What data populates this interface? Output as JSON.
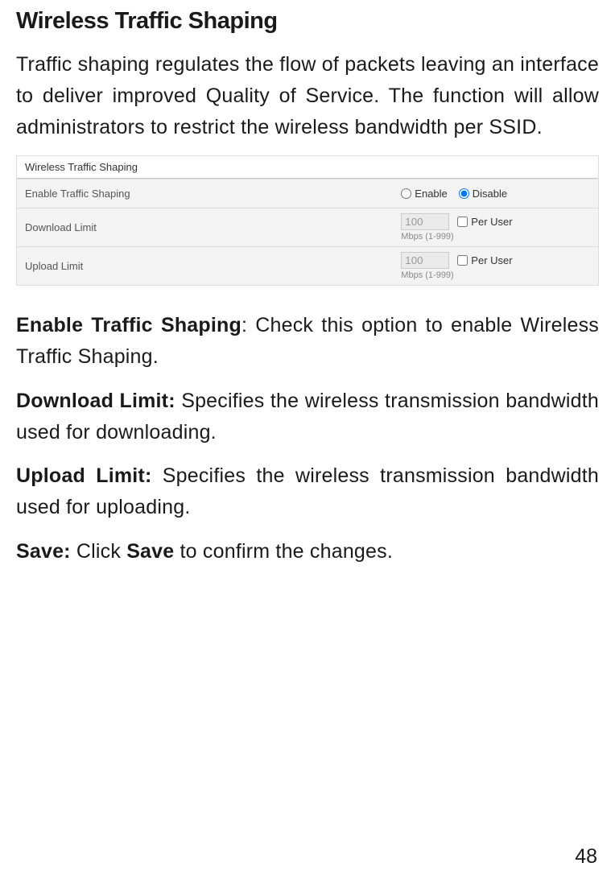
{
  "heading": "Wireless Traffic Shaping",
  "intro": "Traffic shaping regulates the flow of packets leaving an interface to deliver improved Quality of Service. The function will allow administrators to restrict the wireless bandwidth per SSID.",
  "table": {
    "title": "Wireless Traffic Shaping",
    "rows": {
      "enable": {
        "label": "Enable Traffic Shaping",
        "opt_enable": "Enable",
        "opt_disable": "Disable"
      },
      "download": {
        "label": "Download Limit",
        "value": "100",
        "hint": "Mbps (1-999)",
        "per_user": "Per User"
      },
      "upload": {
        "label": "Upload Limit",
        "value": "100",
        "hint": "Mbps (1-999)",
        "per_user": "Per User"
      }
    }
  },
  "defs": {
    "enable_bold": "Enable Traffic Shaping",
    "enable_rest": ": Check this option to enable Wireless Traffic Shaping.",
    "download_bold": "Download Limit:",
    "download_rest": " Specifies the wireless transmission bandwidth used for downloading.",
    "upload_bold": "Upload Limit:",
    "upload_rest": " Specifies the wireless transmission bandwidth used for uploading.",
    "save_bold1": "Save:",
    "save_mid": " Click ",
    "save_bold2": "Save",
    "save_end": " to confirm the changes."
  },
  "page_number": "48"
}
